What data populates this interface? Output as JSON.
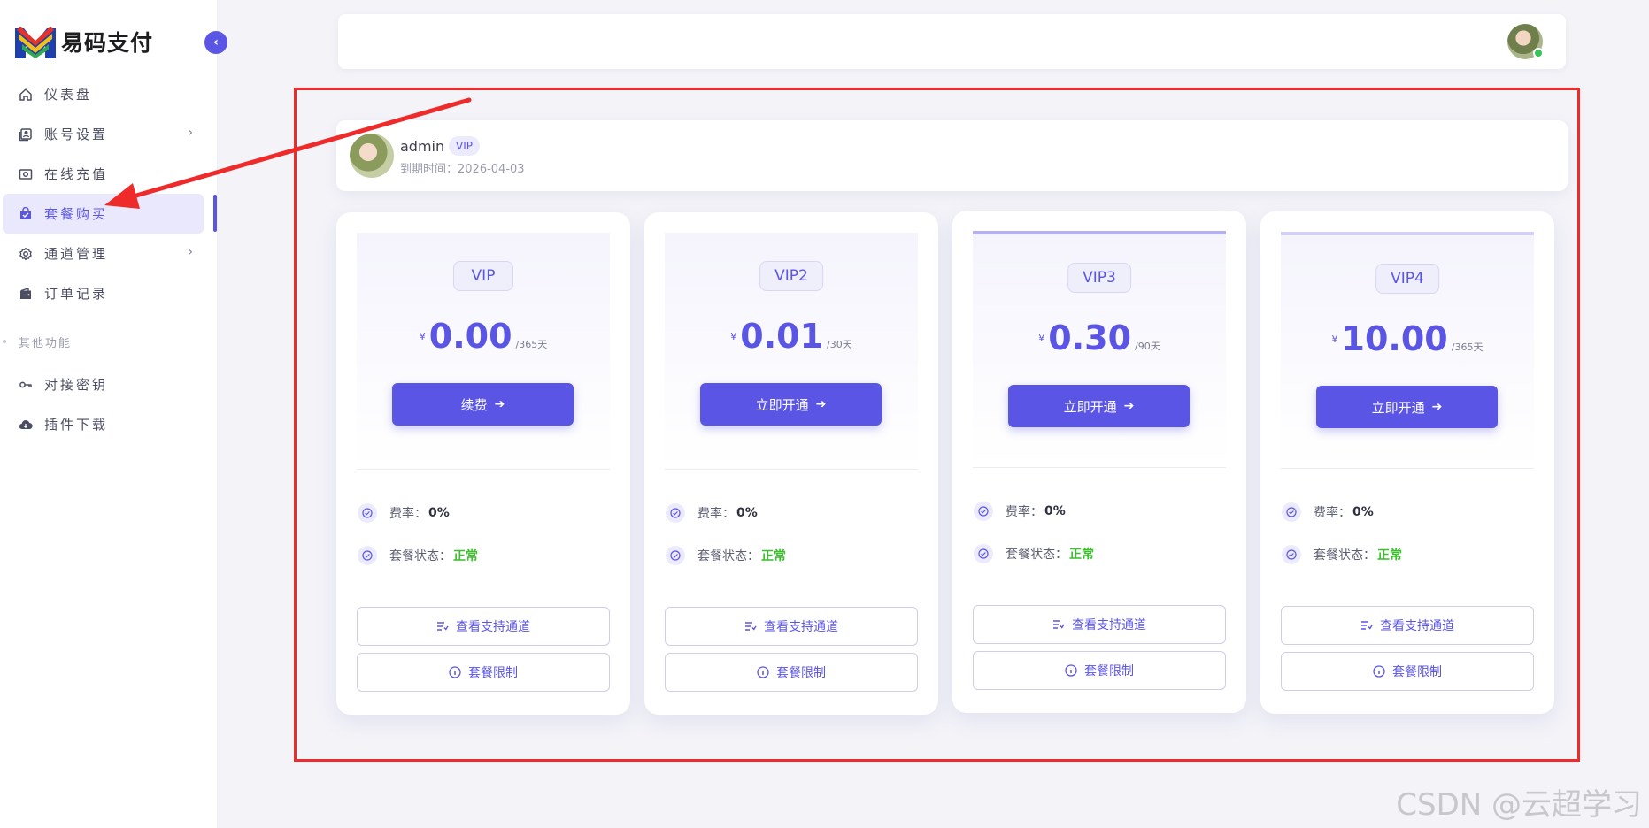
{
  "brand": {
    "name": "易码支付",
    "accent": "#5b55e6"
  },
  "sidebar": {
    "items": [
      {
        "label": "仪表盘",
        "icon": "home-icon"
      },
      {
        "label": "账号设置",
        "icon": "profile-icon",
        "has_children": true
      },
      {
        "label": "在线充值",
        "icon": "cash-icon"
      },
      {
        "label": "套餐购买",
        "icon": "shopping-bag-icon",
        "active": true
      },
      {
        "label": "通道管理",
        "icon": "gear-icon",
        "has_children": true
      },
      {
        "label": "订单记录",
        "icon": "wallet-icon"
      }
    ],
    "section_label": "其他功能",
    "extra_items": [
      {
        "label": "对接密钥",
        "icon": "key-icon"
      },
      {
        "label": "插件下载",
        "icon": "cloud-download-icon"
      }
    ]
  },
  "user": {
    "name": "admin",
    "badge": "VIP",
    "expiry": "到期时间：2026-04-03"
  },
  "plans": [
    {
      "name": "VIP",
      "currency": "¥",
      "price": "0.00",
      "period": "/365天",
      "button": "续费",
      "rate_label": "费率：",
      "rate": "0%",
      "status_label": "套餐状态：",
      "status": "正常",
      "channels_button": "查看支持通道",
      "limits_button": "套餐限制"
    },
    {
      "name": "VIP2",
      "currency": "¥",
      "price": "0.01",
      "period": "/30天",
      "button": "立即开通",
      "rate_label": "费率：",
      "rate": "0%",
      "status_label": "套餐状态：",
      "status": "正常",
      "channels_button": "查看支持通道",
      "limits_button": "套餐限制"
    },
    {
      "name": "VIP3",
      "currency": "¥",
      "price": "0.30",
      "period": "/90天",
      "button": "立即开通",
      "rate_label": "费率：",
      "rate": "0%",
      "status_label": "套餐状态：",
      "status": "正常",
      "channels_button": "查看支持通道",
      "limits_button": "套餐限制"
    },
    {
      "name": "VIP4",
      "currency": "¥",
      "price": "10.00",
      "period": "/365天",
      "button": "立即开通",
      "rate_label": "费率：",
      "rate": "0%",
      "status_label": "套餐状态：",
      "status": "正常",
      "channels_button": "查看支持通道",
      "limits_button": "套餐限制"
    }
  ],
  "watermark": "CSDN @云超学习"
}
